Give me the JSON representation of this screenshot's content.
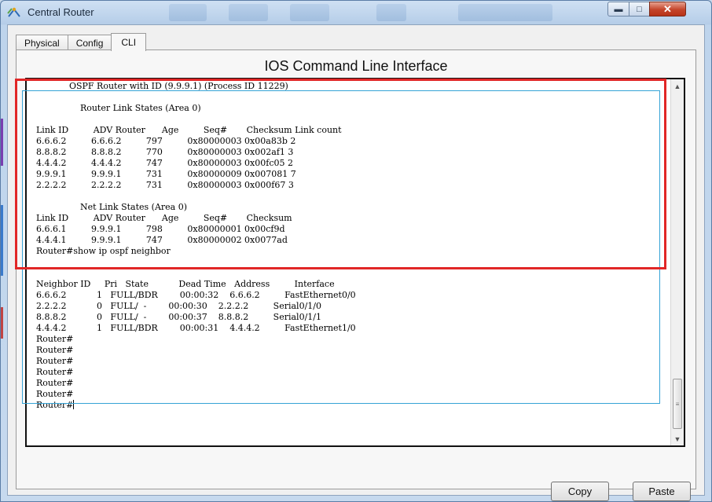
{
  "window": {
    "title": "Central Router",
    "icon": "router-icon",
    "controls": {
      "minimize": "minimize-icon",
      "maximize": "maximize-icon",
      "close": "close-icon"
    },
    "colors": {
      "highlight": "#e12727",
      "selection": "#36a3d6"
    }
  },
  "tabs": [
    {
      "label": "Physical",
      "active": false
    },
    {
      "label": "Config",
      "active": false
    },
    {
      "label": "CLI",
      "active": true
    }
  ],
  "panel": {
    "title": "IOS Command Line Interface"
  },
  "console": {
    "lines": [
      "            OSPF Router with ID (9.9.9.1) (Process ID 11229)",
      "",
      "                Router Link States (Area 0)",
      "",
      "Link ID         ADV Router      Age         Seq#       Checksum Link count",
      "6.6.6.2         6.6.6.2         797         0x80000003 0x00a83b 2",
      "8.8.8.2         8.8.8.2         770         0x80000003 0x002af1 3",
      "4.4.4.2         4.4.4.2         747         0x80000003 0x00fc05 2",
      "9.9.9.1         9.9.9.1         731         0x80000009 0x007081 7",
      "2.2.2.2         2.2.2.2         731         0x80000003 0x000f67 3",
      "",
      "                Net Link States (Area 0)",
      "Link ID         ADV Router      Age         Seq#       Checksum",
      "6.6.6.1         9.9.9.1         798         0x80000001 0x00cf9d",
      "4.4.4.1         9.9.9.1         747         0x80000002 0x0077ad",
      "Router#show ip ospf neighbor",
      "",
      "",
      "Neighbor ID     Pri   State           Dead Time   Address         Interface",
      "6.6.6.2           1   FULL/BDR        00:00:32    6.6.6.2         FastEthernet0/0",
      "2.2.2.2           0   FULL/  -        00:00:30    2.2.2.2         Serial0/1/0",
      "8.8.8.2           0   FULL/  -        00:00:37    8.8.8.2         Serial0/1/1",
      "4.4.4.2           1   FULL/BDR        00:00:31    4.4.4.2         FastEthernet1/0",
      "Router#",
      "Router#",
      "Router#",
      "Router#",
      "Router#",
      "Router#",
      "Router#"
    ],
    "scrollbar": {
      "up_icon": "scroll-up-arrow-icon",
      "down_icon": "scroll-down-arrow-icon",
      "thumb_icon": "scroll-grip-icon"
    }
  },
  "buttons": {
    "copy": "Copy",
    "paste": "Paste"
  }
}
